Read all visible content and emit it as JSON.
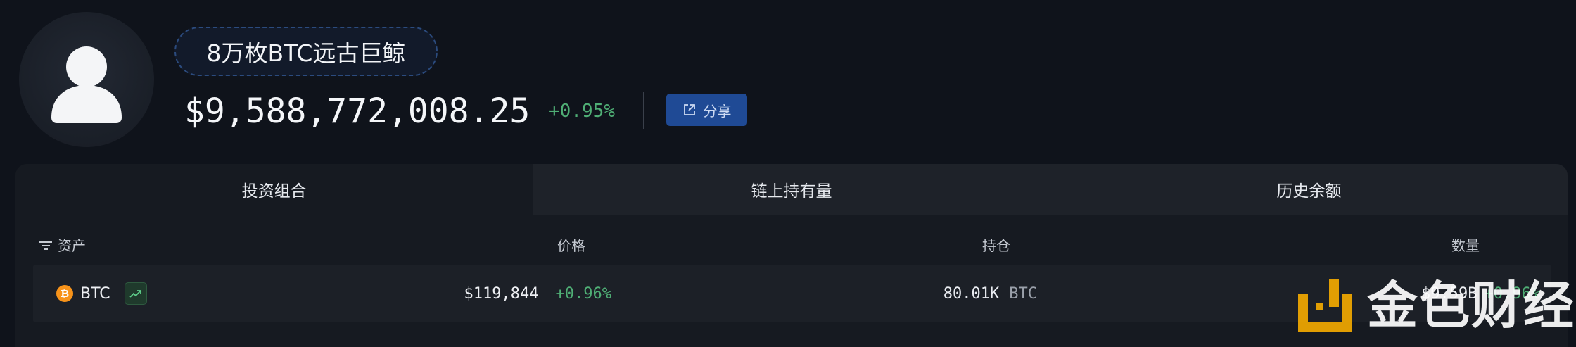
{
  "profile": {
    "wallet_label": "8万枚BTC远古巨鲸",
    "total_value": "$9,588,772,008.25",
    "total_change": "+0.95%",
    "share_label": "分享"
  },
  "tabs": [
    {
      "label": "投资组合",
      "active": true
    },
    {
      "label": "链上持有量",
      "active": false
    },
    {
      "label": "历史余额",
      "active": false
    }
  ],
  "table": {
    "columns": {
      "asset": "资产",
      "price": "价格",
      "holding": "持仓",
      "amount": "数量"
    },
    "rows": [
      {
        "asset": "BTC",
        "price": "$119,844",
        "price_change": "+0.96%",
        "holding_value": "80.01K",
        "holding_unit": "BTC",
        "amount": "$9.59B",
        "amount_change": "+0.96%"
      }
    ]
  },
  "watermark": {
    "text": "金色财经"
  },
  "colors": {
    "background": "#0f131b",
    "positive": "#4fae75",
    "accent": "#1f4a95",
    "btc": "#f7931a",
    "watermark": "#f2a900"
  }
}
